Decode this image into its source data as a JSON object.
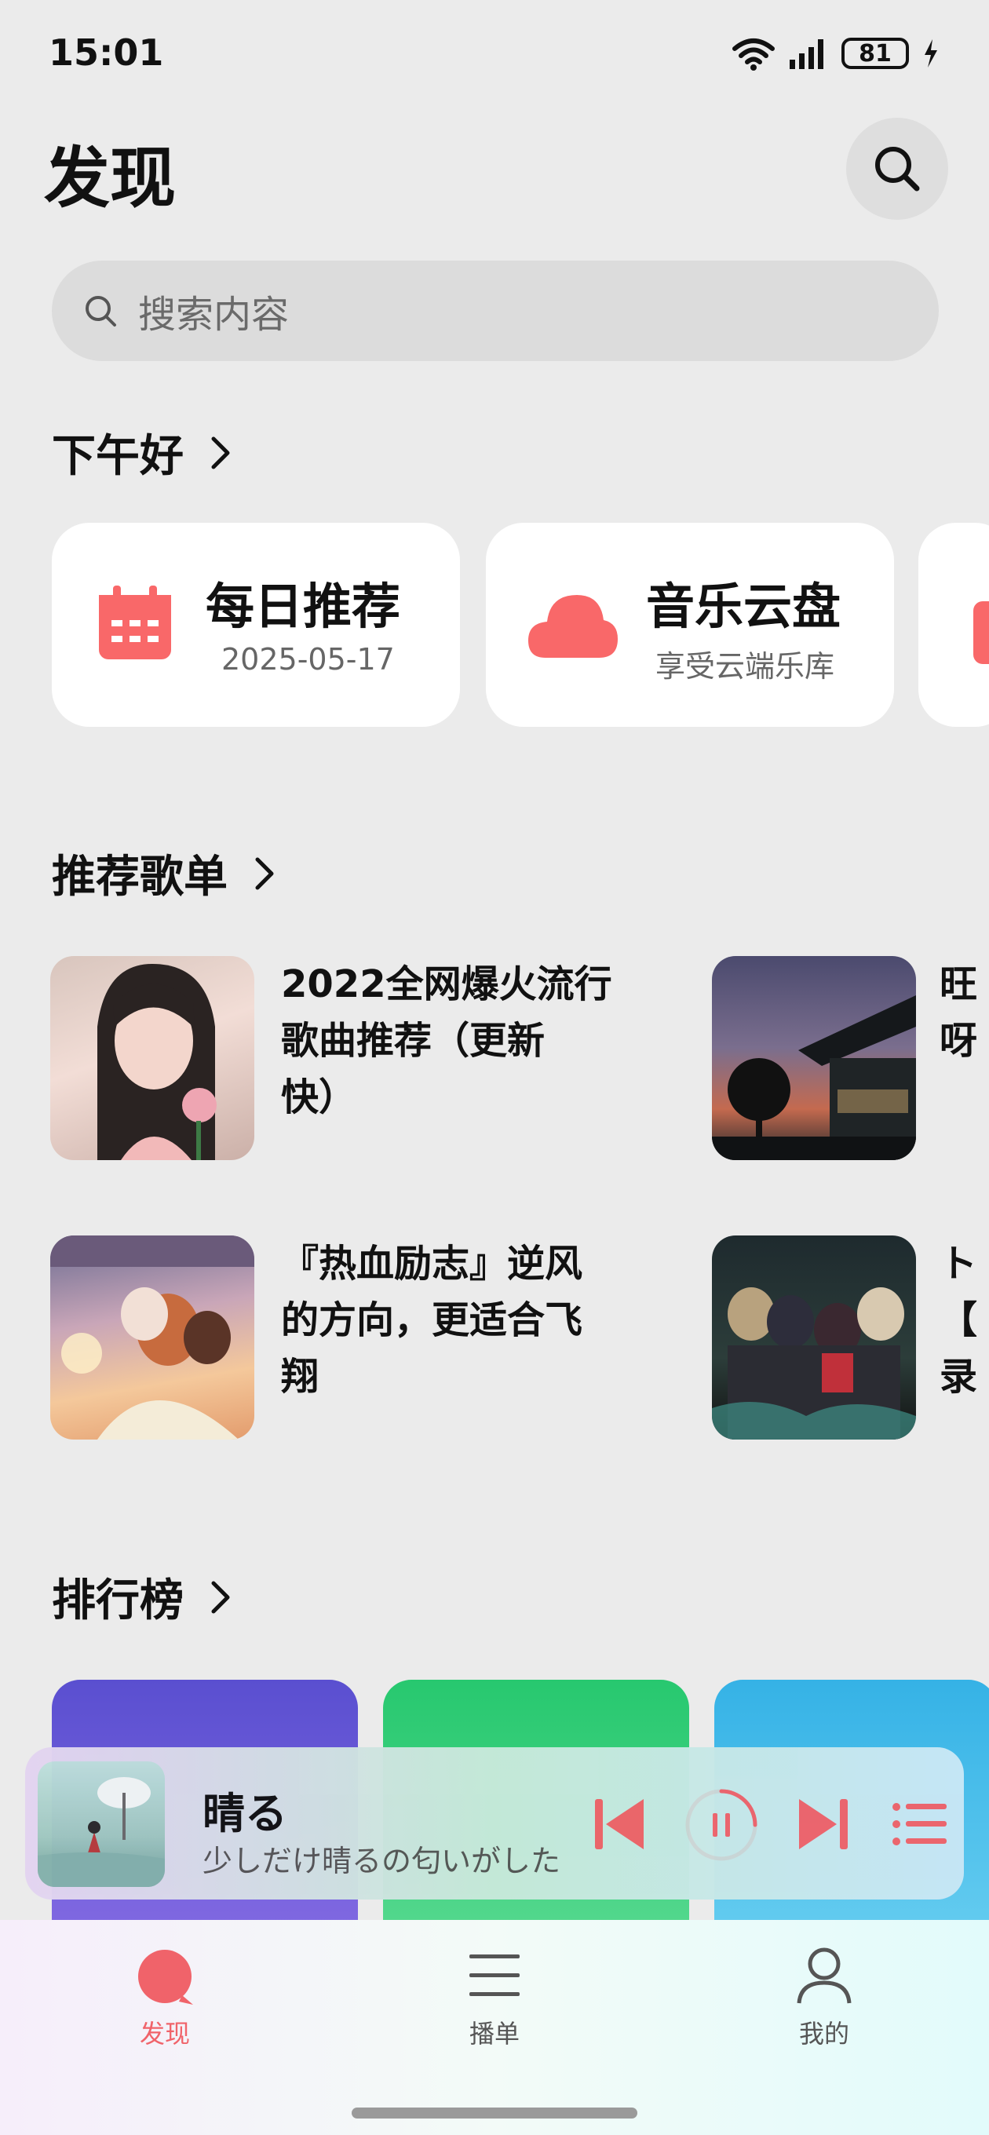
{
  "status_bar": {
    "time": "15:01",
    "battery": "81"
  },
  "header": {
    "title": "发现"
  },
  "search": {
    "placeholder": "搜索内容"
  },
  "greeting": {
    "title": "下午好"
  },
  "quick_cards": [
    {
      "title": "每日推荐",
      "subtitle": "2025-05-17",
      "icon": "calendar-icon"
    },
    {
      "title": "音乐云盘",
      "subtitle": "享受云端乐库",
      "icon": "cloud-icon"
    }
  ],
  "playlists_section": {
    "title": "推荐歌单"
  },
  "playlists": [
    {
      "line1": "2022全网爆火流行",
      "line2": "歌曲推荐（更新",
      "line3": "快）"
    },
    {
      "line1": "旺",
      "line2": "呀",
      "line3": ""
    },
    {
      "line1": "『热血励志』逆风",
      "line2": "的方向，更适合飞",
      "line3": "翔"
    },
    {
      "line1": "ト",
      "line2": "【",
      "line3": "录"
    }
  ],
  "charts_section": {
    "title": "排行榜"
  },
  "now_playing": {
    "title": "晴る",
    "lyric": "少しだけ晴るの匂いがした"
  },
  "bottom_nav": [
    {
      "label": "发现",
      "icon": "discover-icon",
      "active": true
    },
    {
      "label": "播单",
      "icon": "playlist-icon",
      "active": false
    },
    {
      "label": "我的",
      "icon": "profile-icon",
      "active": false
    }
  ],
  "colors": {
    "accent": "#f0636a",
    "background": "#ebebeb"
  }
}
